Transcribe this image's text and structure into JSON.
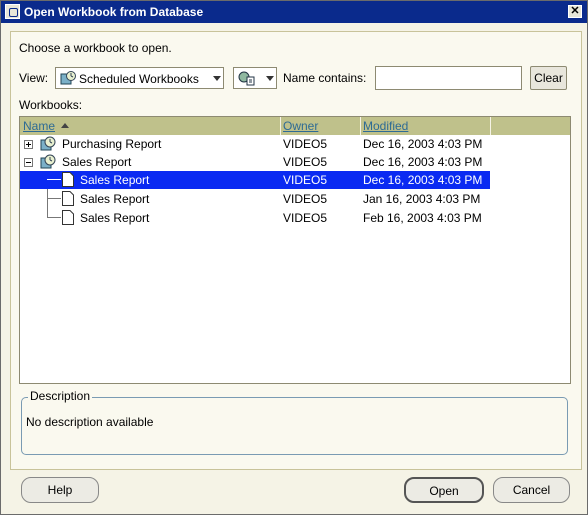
{
  "window": {
    "title": "Open Workbook from Database",
    "close_glyph": "✕"
  },
  "prompt": "Choose a workbook to open.",
  "view": {
    "label": "View:",
    "selected": "Scheduled Workbooks"
  },
  "filter": {
    "label": "Name contains:",
    "value": "",
    "clear_label": "Clear"
  },
  "workbooks_label": "Workbooks:",
  "columns": {
    "name": "Name",
    "owner": "Owner",
    "modified": "Modified"
  },
  "rows": [
    {
      "name": "Purchasing Report",
      "owner": "VIDEO5",
      "modified": "Dec 16, 2003 4:03 PM",
      "type": "folder",
      "expanded": false
    },
    {
      "name": "Sales Report",
      "owner": "VIDEO5",
      "modified": "Dec 16, 2003 4:03 PM",
      "type": "folder",
      "expanded": true
    },
    {
      "name": "Sales Report",
      "owner": "VIDEO5",
      "modified": "Dec 16, 2003 4:03 PM",
      "type": "file",
      "selected": true
    },
    {
      "name": "Sales Report",
      "owner": "VIDEO5",
      "modified": "Jan 16, 2003 4:03 PM",
      "type": "file"
    },
    {
      "name": "Sales Report",
      "owner": "VIDEO5",
      "modified": "Feb 16, 2003 4:03 PM",
      "type": "file"
    }
  ],
  "description": {
    "legend": "Description",
    "text": "No description available"
  },
  "buttons": {
    "help": "Help",
    "open": "Open",
    "cancel": "Cancel"
  },
  "colors": {
    "title_bar": "#0a2a8c",
    "header": "#bfc18b",
    "selection": "#0a2af2"
  }
}
